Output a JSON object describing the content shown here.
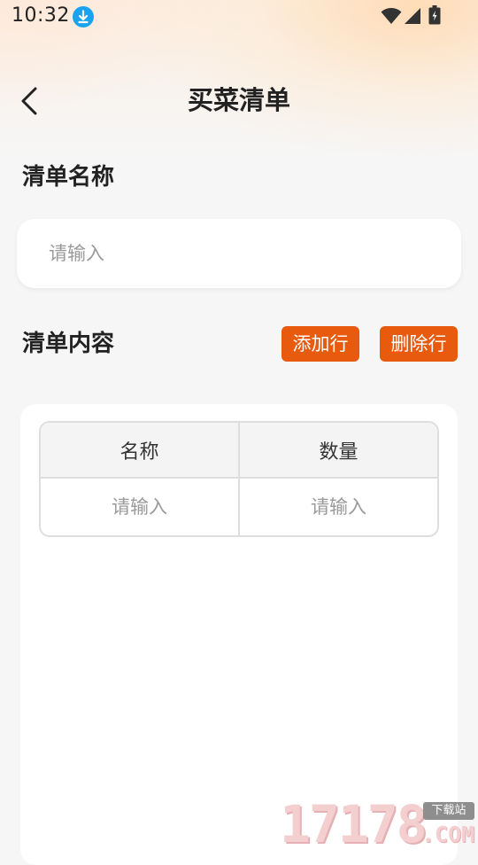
{
  "status_bar": {
    "time": "10:32",
    "icons": [
      "download-icon",
      "wifi-icon",
      "signal-icon",
      "battery-icon"
    ]
  },
  "header": {
    "back_icon": "chevron-left-icon",
    "title": "买菜清单"
  },
  "list_name": {
    "heading": "清单名称",
    "input_value": "",
    "placeholder": "请输入"
  },
  "list_content": {
    "heading": "清单内容",
    "add_row_label": "添加行",
    "delete_row_label": "删除行",
    "table": {
      "columns": [
        "名称",
        "数量"
      ],
      "rows": [
        {
          "name_placeholder": "请输入",
          "quantity_placeholder": "请输入"
        }
      ]
    }
  },
  "watermark": {
    "digits": "17178",
    "site_label": "下载站",
    "suffix": ".COM"
  },
  "colors": {
    "accent": "#e85a0e",
    "background": "#f6f6f6",
    "card": "#ffffff",
    "border": "#dedede",
    "placeholder": "#9a9a9a"
  }
}
